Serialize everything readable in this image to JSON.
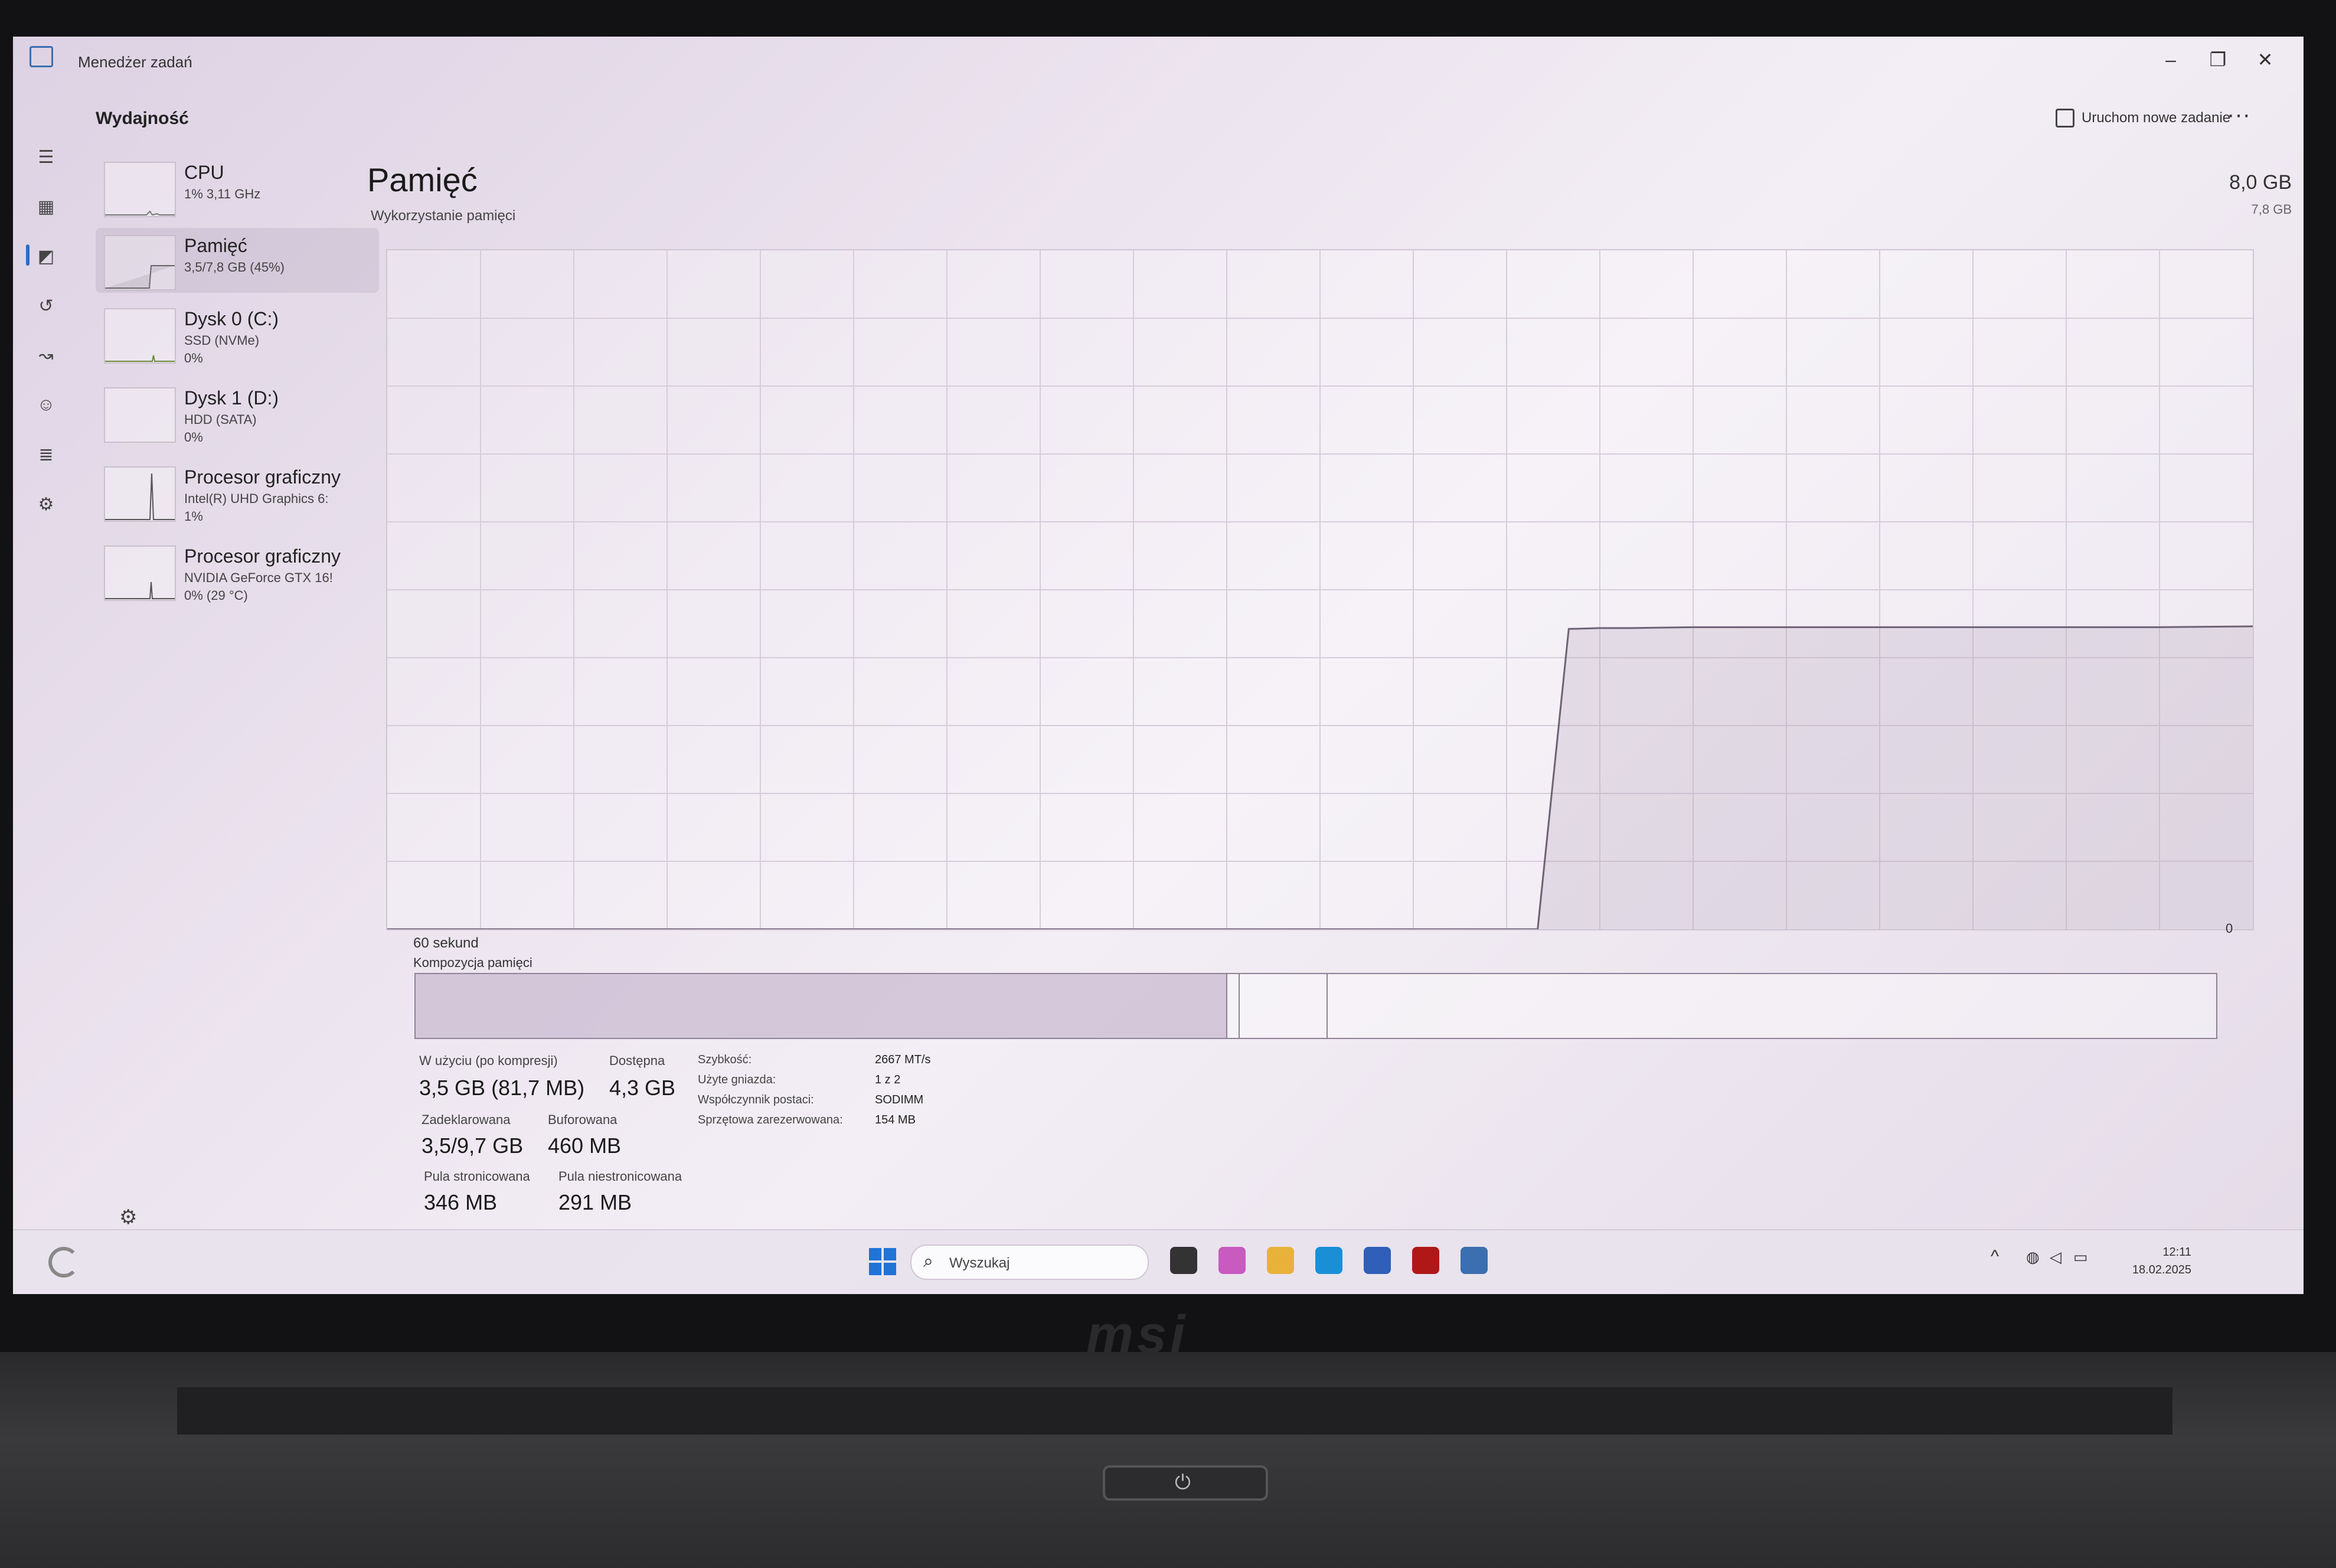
{
  "window": {
    "title": "Menedżer zadań",
    "min_glyph": "–",
    "max_glyph": "❐",
    "close_glyph": "✕"
  },
  "header": {
    "title": "Wydajność",
    "run_task_label": "Uruchom nowe zadanie",
    "more_glyph": "···"
  },
  "rail_icons": [
    "hamburger-icon",
    "processes-icon",
    "performance-icon",
    "history-icon",
    "startup-icon",
    "users-icon",
    "details-icon",
    "services-icon"
  ],
  "sidebar": {
    "items": [
      {
        "name": "CPU",
        "line1": "1% 3,11 GHz",
        "line2": ""
      },
      {
        "name": "Pamięć",
        "line1": "3,5/7,8 GB (45%)",
        "line2": ""
      },
      {
        "name": "Dysk 0 (C:)",
        "line1": "SSD (NVMe)",
        "line2": "0%"
      },
      {
        "name": "Dysk 1 (D:)",
        "line1": "HDD (SATA)",
        "line2": "0%"
      },
      {
        "name": "Procesor graficzny",
        "line1": "Intel(R) UHD Graphics 6:",
        "line2": "1%"
      },
      {
        "name": "Procesor graficzny",
        "line1": "NVIDIA GeForce GTX 16!",
        "line2": "0% (29 °C)"
      }
    ]
  },
  "main": {
    "title": "Pamięć",
    "total": "8,0 GB",
    "subtitle": "Wykorzystanie pamięci",
    "max_label": "7,8 GB",
    "x_left_label": "60 sekund",
    "x_right_label": "0",
    "composition_label": "Kompozycja pamięci",
    "composition": {
      "in_use_fraction": 0.45,
      "modified_fraction": 0.007,
      "standby_fraction": 0.049
    }
  },
  "chart_data": {
    "type": "area",
    "title": "Wykorzystanie pamięci",
    "xlabel": "",
    "ylabel": "",
    "x": [
      60,
      57,
      54,
      51,
      48,
      45,
      42,
      39,
      36,
      33,
      30,
      27,
      24,
      23,
      22,
      21,
      20,
      18,
      15,
      12,
      9,
      6,
      3,
      0
    ],
    "values": [
      0,
      0,
      0,
      0,
      0,
      0,
      0,
      0,
      0,
      0,
      0,
      0,
      0,
      0,
      3.45,
      3.46,
      3.46,
      3.47,
      3.47,
      3.47,
      3.47,
      3.47,
      3.47,
      3.48
    ],
    "xlim": [
      60,
      0
    ],
    "ylim": [
      0,
      7.8
    ],
    "grid": true
  },
  "stats": {
    "in_use_label": "W użyciu (po kompresji)",
    "in_use_value": "3,5 GB (81,7 MB)",
    "available_label": "Dostępna",
    "available_value": "4,3 GB",
    "committed_label": "Zadeklarowana",
    "committed_value": "3,5/9,7 GB",
    "cached_label": "Buforowana",
    "cached_value": "460 MB",
    "paged_label": "Pula stronicowana",
    "paged_value": "346 MB",
    "nonpaged_label": "Pula niestronicowana",
    "nonpaged_value": "291 MB"
  },
  "details": [
    {
      "key": "Szybkość:",
      "value": "2667 MT/s"
    },
    {
      "key": "Użyte gniazda:",
      "value": "1 z 2"
    },
    {
      "key": "Współczynnik postaci:",
      "value": "SODIMM"
    },
    {
      "key": "Sprzętowa zarezerwowana:",
      "value": "154 MB"
    }
  ],
  "taskbar": {
    "search_placeholder": "Wyszukaj",
    "time": "12:11",
    "date": "18.02.2025",
    "apps": [
      {
        "icon": "task-view-icon",
        "color": "#333333"
      },
      {
        "icon": "copilot-icon",
        "color": "#c85ac0"
      },
      {
        "icon": "file-explorer-icon",
        "color": "#e8b23a"
      },
      {
        "icon": "edge-icon",
        "color": "#1b8fd6"
      },
      {
        "icon": "store-icon",
        "color": "#2f5fb8"
      },
      {
        "icon": "msi-app-icon",
        "color": "#b01818"
      },
      {
        "icon": "task-manager-icon",
        "color": "#3b6fb0"
      }
    ]
  },
  "colors": {
    "accent": "#2f6bc6",
    "memory_purple": "#8f8197"
  },
  "device": {
    "brand": "msi"
  }
}
